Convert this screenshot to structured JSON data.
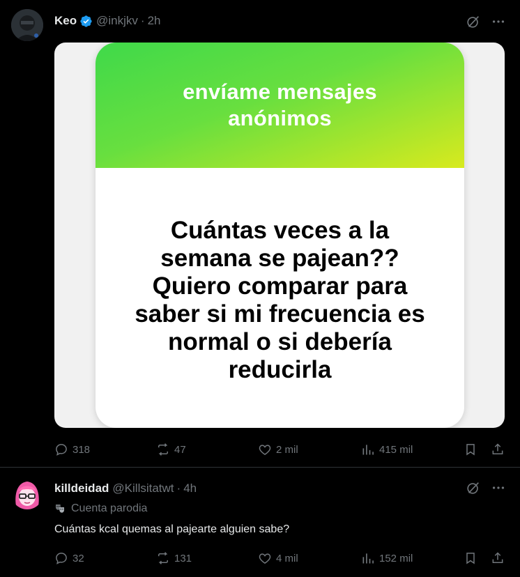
{
  "post1": {
    "author_name": "Keo",
    "handle": "@inkjkv",
    "separator": "·",
    "time": "2h",
    "image": {
      "header_text": "envíame mensajes anónimos",
      "question_text": "Cuántas veces a la semana se pajean?? Quiero comparar para saber si mi frecuencia es normal o si debería reducirla"
    },
    "actions": {
      "replies": "318",
      "reposts": "47",
      "likes": "2 mil",
      "views": "415 mil"
    }
  },
  "post2": {
    "author_name": "killdeidad",
    "handle": "@Killsitatwt",
    "separator": "·",
    "time": "4h",
    "parody_label": "Cuenta parodia",
    "text": "Cuántas kcal quemas al pajearte alguien sabe?",
    "actions": {
      "replies": "32",
      "reposts": "131",
      "likes": "4 mil",
      "views": "152 mil"
    }
  },
  "colors": {
    "background": "#000000",
    "text_primary": "#e7e9ea",
    "text_secondary": "#71767b",
    "verified_blue": "#1d9bf0",
    "card_gradient_start": "#3fd94a",
    "card_gradient_end": "#d8ea1e",
    "divider": "#2f3336"
  },
  "icons": [
    "verified-badge-icon",
    "grok-icon",
    "more-icon",
    "reply-icon",
    "repost-icon",
    "like-icon",
    "views-icon",
    "bookmark-icon",
    "share-icon",
    "parody-mask-icon"
  ]
}
